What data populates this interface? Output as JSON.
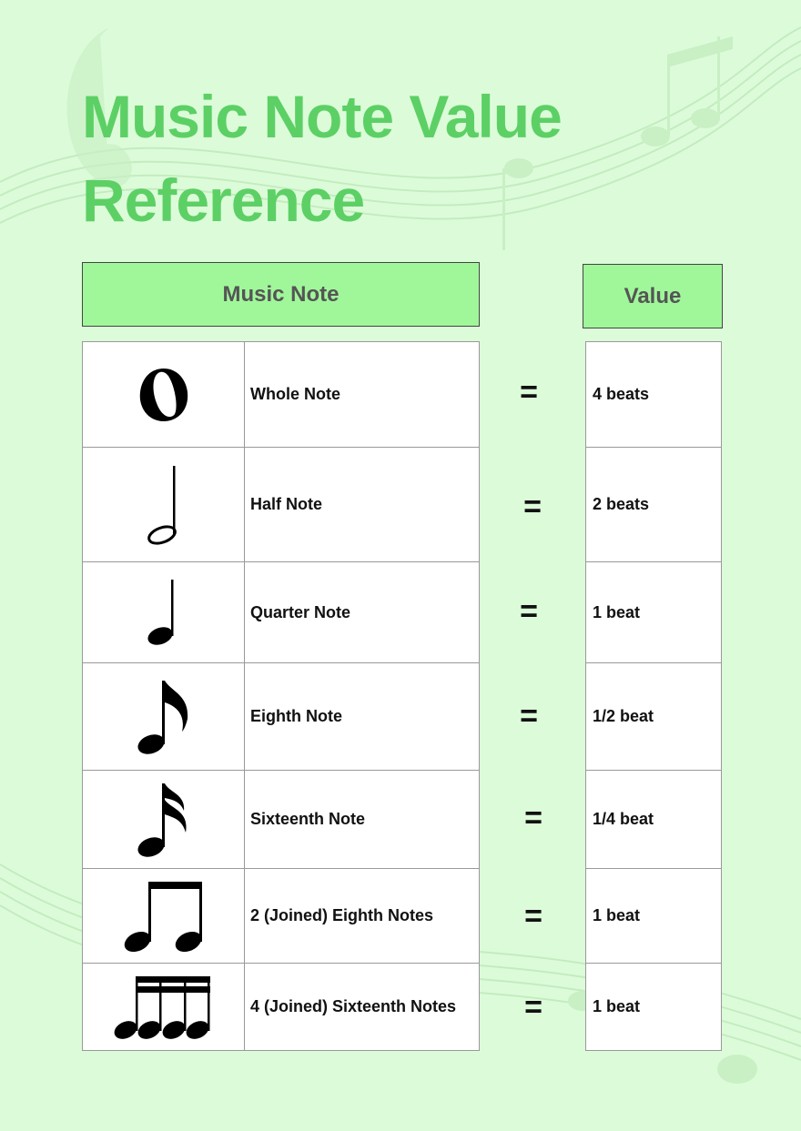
{
  "title_line1": "Music Note Value",
  "title_line2": "Reference",
  "headers": {
    "note": "Music Note",
    "value": "Value"
  },
  "equals_symbol": "=",
  "rows": [
    {
      "icon": "whole-note-icon",
      "name": "Whole Note",
      "value": "4 beats"
    },
    {
      "icon": "half-note-icon",
      "name": "Half Note",
      "value": "2 beats"
    },
    {
      "icon": "quarter-note-icon",
      "name": "Quarter Note",
      "value": "1 beat"
    },
    {
      "icon": "eighth-note-icon",
      "name": "Eighth Note",
      "value": "1/2 beat"
    },
    {
      "icon": "sixteenth-note-icon",
      "name": "Sixteenth Note",
      "value": "1/4 beat"
    },
    {
      "icon": "joined-eighth-notes-icon",
      "name": "2 (Joined) Eighth Notes",
      "value": "1 beat"
    },
    {
      "icon": "joined-sixteenth-notes-icon",
      "name": "4 (Joined) Sixteenth Notes",
      "value": "1 beat"
    }
  ],
  "colors": {
    "background": "#dcfcd9",
    "title": "#5cd065",
    "header_fill": "#a0f79a",
    "header_text": "#555555"
  }
}
